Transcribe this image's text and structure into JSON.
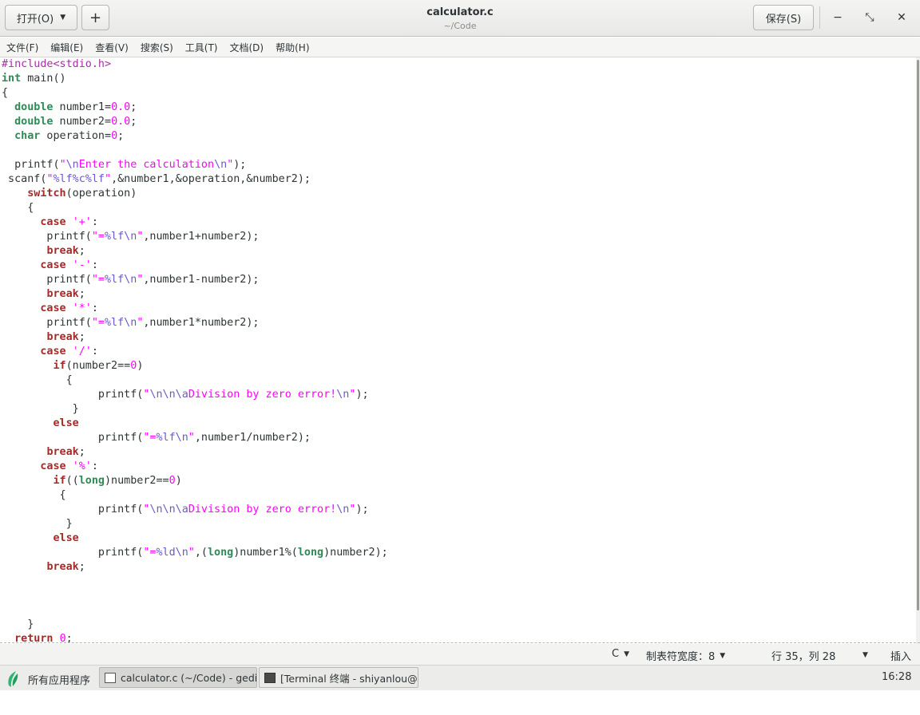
{
  "header": {
    "open_label": "打开(O)",
    "new_label": "+",
    "title": "calculator.c",
    "subtitle": "~/Code",
    "save_label": "保存(S)",
    "minimize_icon": "−",
    "maximize_icon": "⤡",
    "close_icon": "✕"
  },
  "menu": {
    "items": [
      "文件(F)",
      "编辑(E)",
      "查看(V)",
      "搜索(S)",
      "工具(T)",
      "文档(D)",
      "帮助(H)"
    ]
  },
  "editor": {
    "lines": [
      [
        [
          "pre",
          "#include<stdio.h>"
        ]
      ],
      [
        [
          "type",
          "int"
        ],
        [
          "txt",
          " main()"
        ]
      ],
      [
        [
          "txt",
          "{"
        ]
      ],
      [
        [
          "txt",
          "  "
        ],
        [
          "type",
          "double"
        ],
        [
          "txt",
          " number1="
        ],
        [
          "num",
          "0.0"
        ],
        [
          "txt",
          ";"
        ]
      ],
      [
        [
          "txt",
          "  "
        ],
        [
          "type",
          "double"
        ],
        [
          "txt",
          " number2="
        ],
        [
          "num",
          "0.0"
        ],
        [
          "txt",
          ";"
        ]
      ],
      [
        [
          "txt",
          "  "
        ],
        [
          "type",
          "char"
        ],
        [
          "txt",
          " operation="
        ],
        [
          "num",
          "0"
        ],
        [
          "txt",
          ";"
        ]
      ],
      [
        [
          "txt",
          ""
        ]
      ],
      [
        [
          "txt",
          "  printf("
        ],
        [
          "str",
          "\""
        ],
        [
          "esc",
          "\\n"
        ],
        [
          "str",
          "Enter the calculation"
        ],
        [
          "esc",
          "\\n"
        ],
        [
          "str",
          "\""
        ],
        [
          "txt",
          ");"
        ]
      ],
      [
        [
          "txt",
          " scanf("
        ],
        [
          "str",
          "\""
        ],
        [
          "esc",
          "%lf%c%lf"
        ],
        [
          "str",
          "\""
        ],
        [
          "txt",
          ",&number1,&operation,&number2);"
        ]
      ],
      [
        [
          "txt",
          "    "
        ],
        [
          "kw",
          "switch"
        ],
        [
          "txt",
          "(operation)"
        ]
      ],
      [
        [
          "txt",
          "    {"
        ]
      ],
      [
        [
          "txt",
          "      "
        ],
        [
          "kw",
          "case"
        ],
        [
          "txt",
          " "
        ],
        [
          "str",
          "'+'"
        ],
        [
          "txt",
          ":"
        ]
      ],
      [
        [
          "txt",
          "       printf("
        ],
        [
          "str",
          "\"="
        ],
        [
          "esc",
          "%lf\\n"
        ],
        [
          "str",
          "\""
        ],
        [
          "txt",
          ",number1+number2);"
        ]
      ],
      [
        [
          "txt",
          "       "
        ],
        [
          "kw",
          "break"
        ],
        [
          "txt",
          ";"
        ]
      ],
      [
        [
          "txt",
          "      "
        ],
        [
          "kw",
          "case"
        ],
        [
          "txt",
          " "
        ],
        [
          "str",
          "'-'"
        ],
        [
          "txt",
          ":"
        ]
      ],
      [
        [
          "txt",
          "       printf("
        ],
        [
          "str",
          "\"="
        ],
        [
          "esc",
          "%lf\\n"
        ],
        [
          "str",
          "\""
        ],
        [
          "txt",
          ",number1-number2);"
        ]
      ],
      [
        [
          "txt",
          "       "
        ],
        [
          "kw",
          "break"
        ],
        [
          "txt",
          ";"
        ]
      ],
      [
        [
          "txt",
          "      "
        ],
        [
          "kw",
          "case"
        ],
        [
          "txt",
          " "
        ],
        [
          "str",
          "'*'"
        ],
        [
          "txt",
          ":"
        ]
      ],
      [
        [
          "txt",
          "       printf("
        ],
        [
          "str",
          "\"="
        ],
        [
          "esc",
          "%lf\\n"
        ],
        [
          "str",
          "\""
        ],
        [
          "txt",
          ",number1*number2);"
        ]
      ],
      [
        [
          "txt",
          "       "
        ],
        [
          "kw",
          "break"
        ],
        [
          "txt",
          ";"
        ]
      ],
      [
        [
          "txt",
          "      "
        ],
        [
          "kw",
          "case"
        ],
        [
          "txt",
          " "
        ],
        [
          "str",
          "'/'"
        ],
        [
          "txt",
          ":"
        ]
      ],
      [
        [
          "txt",
          "        "
        ],
        [
          "kw",
          "if"
        ],
        [
          "txt",
          "(number2=="
        ],
        [
          "num",
          "0"
        ],
        [
          "txt",
          ")"
        ]
      ],
      [
        [
          "txt",
          "          {"
        ]
      ],
      [
        [
          "txt",
          "               printf("
        ],
        [
          "str",
          "\""
        ],
        [
          "esc",
          "\\n\\n\\a"
        ],
        [
          "str",
          "Division by zero error!"
        ],
        [
          "esc",
          "\\n"
        ],
        [
          "str",
          "\""
        ],
        [
          "txt",
          ");"
        ]
      ],
      [
        [
          "txt",
          "           }"
        ]
      ],
      [
        [
          "txt",
          "        "
        ],
        [
          "kw",
          "else"
        ]
      ],
      [
        [
          "txt",
          "               printf("
        ],
        [
          "str",
          "\"="
        ],
        [
          "esc",
          "%lf\\n"
        ],
        [
          "str",
          "\""
        ],
        [
          "txt",
          ",number1/number2);"
        ]
      ],
      [
        [
          "txt",
          "       "
        ],
        [
          "kw",
          "break"
        ],
        [
          "txt",
          ";"
        ]
      ],
      [
        [
          "txt",
          "      "
        ],
        [
          "kw",
          "case"
        ],
        [
          "txt",
          " "
        ],
        [
          "str",
          "'%'"
        ],
        [
          "txt",
          ":"
        ]
      ],
      [
        [
          "txt",
          "        "
        ],
        [
          "kw",
          "if"
        ],
        [
          "txt",
          "(("
        ],
        [
          "type",
          "long"
        ],
        [
          "txt",
          ")number2=="
        ],
        [
          "num",
          "0"
        ],
        [
          "txt",
          ")"
        ]
      ],
      [
        [
          "txt",
          "         {"
        ]
      ],
      [
        [
          "txt",
          "               printf("
        ],
        [
          "str",
          "\""
        ],
        [
          "esc",
          "\\n\\n\\a"
        ],
        [
          "str",
          "Division by zero error!"
        ],
        [
          "esc",
          "\\n"
        ],
        [
          "str",
          "\""
        ],
        [
          "txt",
          ");"
        ]
      ],
      [
        [
          "txt",
          "          }"
        ]
      ],
      [
        [
          "txt",
          "        "
        ],
        [
          "kw",
          "else"
        ]
      ],
      [
        [
          "txt",
          "               printf("
        ],
        [
          "str",
          "\"="
        ],
        [
          "esc",
          "%ld\\n"
        ],
        [
          "str",
          "\""
        ],
        [
          "txt",
          ",("
        ],
        [
          "type",
          "long"
        ],
        [
          "txt",
          ")number1%("
        ],
        [
          "type",
          "long"
        ],
        [
          "txt",
          ")number2);"
        ]
      ],
      [
        [
          "txt",
          "       "
        ],
        [
          "kw",
          "break"
        ],
        [
          "txt",
          ";"
        ]
      ],
      [
        [
          "txt",
          ""
        ]
      ],
      [
        [
          "txt",
          ""
        ]
      ],
      [
        [
          "txt",
          ""
        ]
      ],
      [
        [
          "txt",
          "    }"
        ]
      ],
      [
        [
          "txt",
          "  "
        ],
        [
          "kw",
          "return"
        ],
        [
          "txt",
          " "
        ],
        [
          "num",
          "0"
        ],
        [
          "txt",
          ";"
        ]
      ]
    ]
  },
  "status": {
    "language": "C",
    "tab_width": "制表符宽度：8",
    "position": "行 35，列 28",
    "mode": "插入"
  },
  "taskbar": {
    "apps_label": "所有应用程序",
    "task1": "calculator.c (~/Code) - gedit",
    "task2": "[Terminal 终端 - shiyanlou@…",
    "clock": "16:28"
  }
}
